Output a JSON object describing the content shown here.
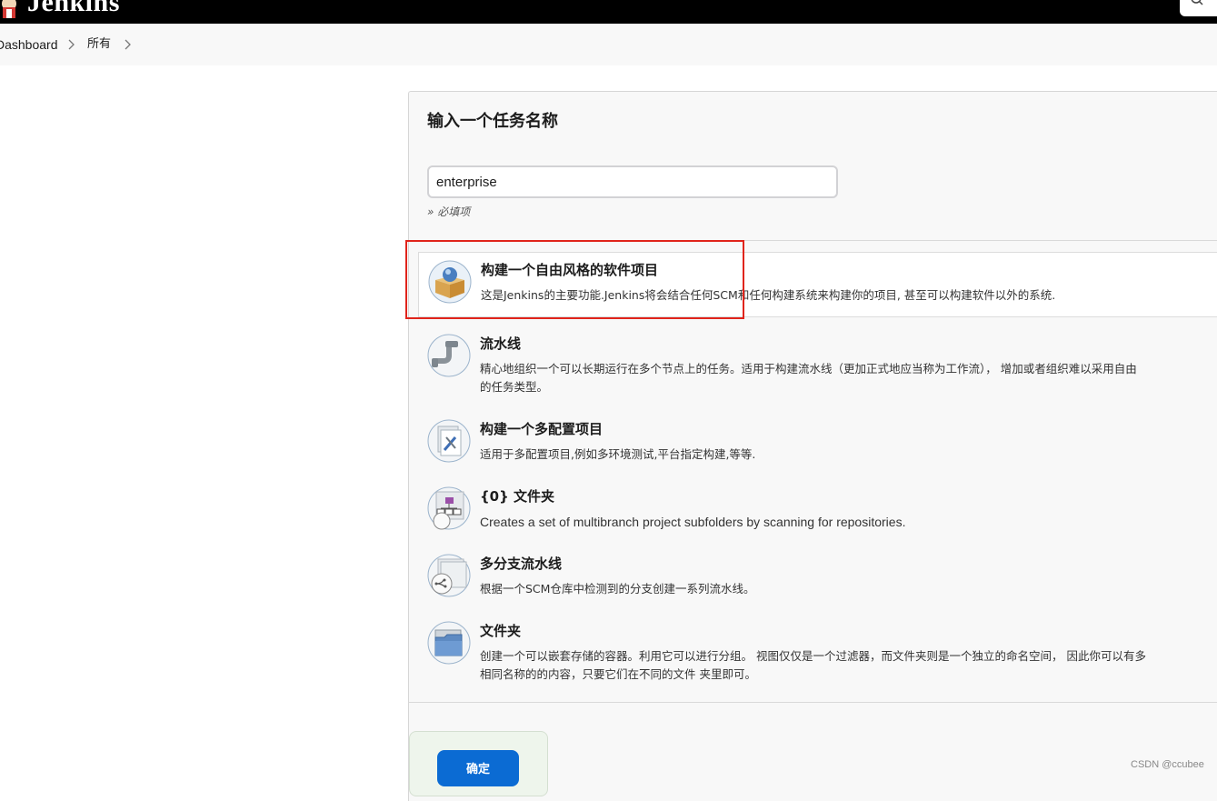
{
  "header": {
    "logo_text": "Jenkins"
  },
  "breadcrumb": {
    "items": [
      "Dashboard",
      "所有"
    ]
  },
  "form": {
    "title": "输入一个任务名称",
    "name_value": "enterprise",
    "required_hint": "» 必填项"
  },
  "job_types": [
    {
      "label": "构建一个自由风格的软件项目",
      "description": [
        "这是Jenkins的主要功能.Jenkins将会结合任何SCM和任何构建系统来构建你的项目, 甚至可以构建软件以外的系统."
      ],
      "icon": "freestyle-box-icon",
      "selected": true
    },
    {
      "label": "流水线",
      "description": [
        "精心地组织一个可以长期运行在多个节点上的任务。适用于构建流水线（更加正式地应当称为工作流）， 增加或者组织难以采用自由",
        "的任务类型。"
      ],
      "icon": "pipeline-icon",
      "selected": false
    },
    {
      "label": "构建一个多配置项目",
      "description": [
        "适用于多配置项目,例如多环境测试,平台指定构建,等等."
      ],
      "icon": "multi-config-icon",
      "selected": false
    },
    {
      "label": "{0} 文件夹",
      "description": [
        "Creates a set of multibranch project subfolders by scanning for repositories."
      ],
      "icon": "org-folder-icon",
      "selected": false
    },
    {
      "label": "多分支流水线",
      "description": [
        "根据一个SCM仓库中检测到的分支创建一系列流水线。"
      ],
      "icon": "multibranch-icon",
      "selected": false
    },
    {
      "label": "文件夹",
      "description": [
        "创建一个可以嵌套存储的容器。利用它可以进行分组。 视图仅仅是一个过滤器，而文件夹则是一个独立的命名空间， 因此你可以有多",
        "相同名称的的内容，只要它们在不同的文件 夹里即可。"
      ],
      "icon": "folder-icon",
      "selected": false
    }
  ],
  "ok_button": {
    "label": "确定"
  },
  "watermark": "CSDN @ccubee",
  "colors": {
    "header_bg": "#000000",
    "accent_blue": "#0b6bd3",
    "highlight_red": "#e0241b"
  }
}
